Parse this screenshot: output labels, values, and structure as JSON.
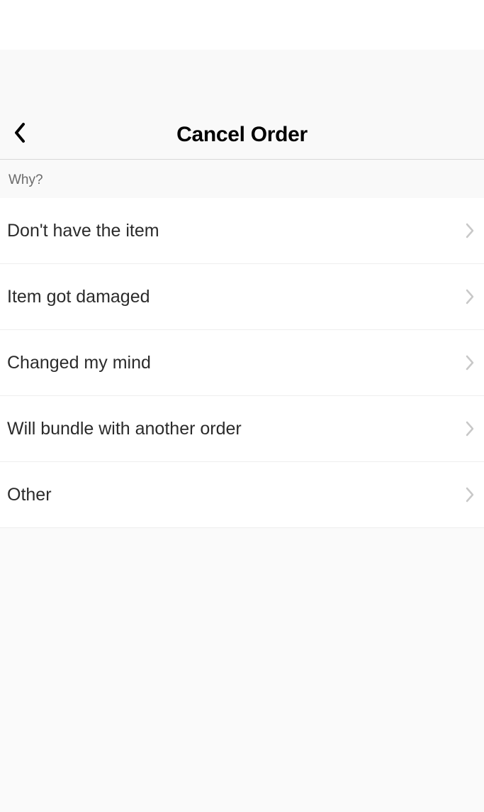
{
  "header": {
    "title": "Cancel Order"
  },
  "section": {
    "label": "Why?"
  },
  "reasons": [
    {
      "label": "Don't have the item"
    },
    {
      "label": "Item got damaged"
    },
    {
      "label": "Changed my mind"
    },
    {
      "label": "Will bundle with another order"
    },
    {
      "label": "Other"
    }
  ]
}
